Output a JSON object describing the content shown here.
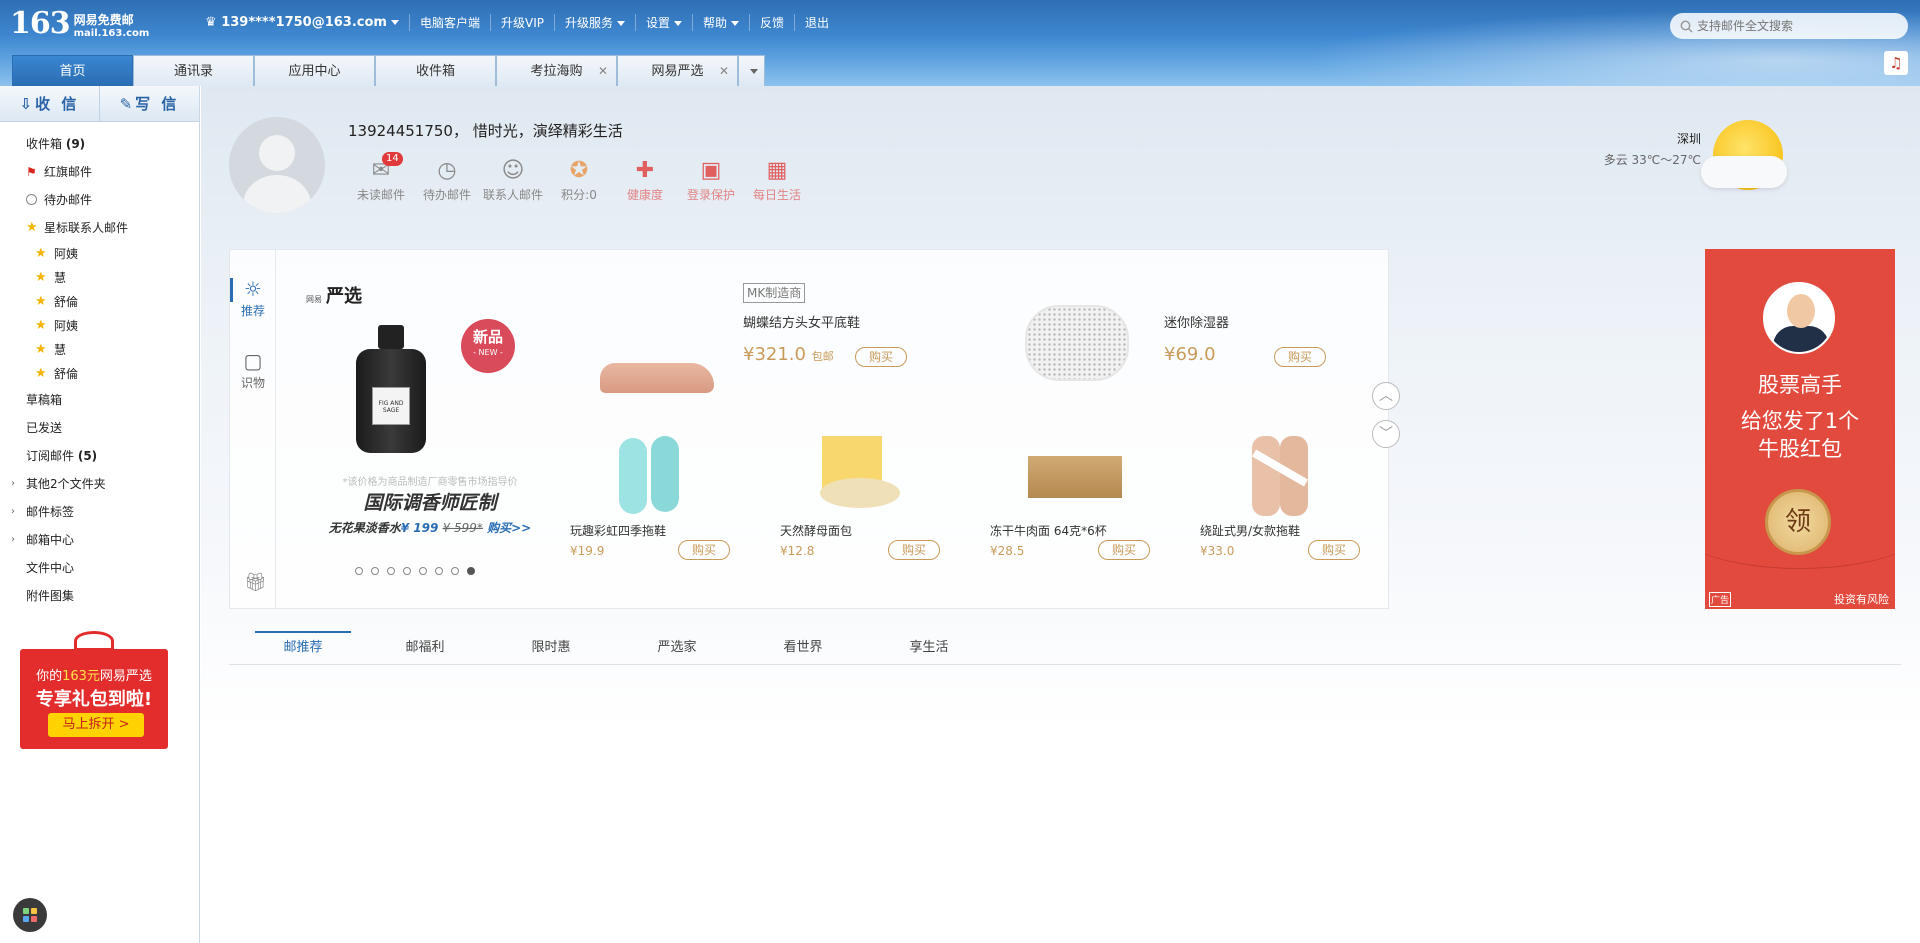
{
  "header": {
    "logo_num": "163",
    "logo_name": "网易免费邮",
    "logo_domain": "mail.163.com",
    "account": "139****1750@163.com",
    "links": [
      "电脑客户端",
      "升级VIP",
      "升级服务",
      "设置",
      "帮助",
      "反馈",
      "退出"
    ],
    "search_placeholder": "支持邮件全文搜索"
  },
  "tabs": [
    {
      "label": "首页"
    },
    {
      "label": "通讯录"
    },
    {
      "label": "应用中心"
    },
    {
      "label": "收件箱"
    },
    {
      "label": "考拉海购"
    },
    {
      "label": "网易严选"
    }
  ],
  "sidebar": {
    "receive": "收 信",
    "write": "写 信",
    "folders": {
      "inbox": "收件箱",
      "inbox_count": "(9)",
      "flagged": "红旗邮件",
      "todo": "待办邮件",
      "starred": "星标联系人邮件",
      "contacts": [
        "阿姨",
        "慧",
        "舒倫",
        "阿姨",
        "慧",
        "舒倫"
      ],
      "drafts": "草稿箱",
      "sent": "已发送",
      "subs": "订阅邮件",
      "subs_count": "(5)",
      "other": "其他2个文件夹",
      "tags": "邮件标签",
      "center": "邮箱中心",
      "files": "文件中心",
      "attach": "附件图集"
    },
    "gift_ad": {
      "line1_pre": "你的",
      "line1_amt": "163元",
      "line1_post": "网易严选",
      "line2": "专享礼包到啦!",
      "button": "马上拆开 >"
    }
  },
  "profile": {
    "greeting": "13924451750， 惜时光，演绎精彩生活",
    "quick": [
      {
        "label": "未读邮件",
        "icon": "envelope-icon",
        "badge": "14"
      },
      {
        "label": "待办邮件",
        "icon": "clock-icon"
      },
      {
        "label": "联系人邮件",
        "icon": "contact-star-icon"
      },
      {
        "label": "积分:0",
        "icon": "coin-icon"
      },
      {
        "label": "健康度",
        "icon": "medkit-icon"
      },
      {
        "label": "登录保护",
        "icon": "lock-box-icon"
      },
      {
        "label": "每日生活",
        "icon": "calendar-icon"
      }
    ],
    "weather": {
      "city": "深圳",
      "desc": "多云 33℃～27℃"
    }
  },
  "panel": {
    "nav": [
      "推荐",
      "识物"
    ],
    "brand_small": "网易",
    "brand": "严选",
    "feature": {
      "new_tag": "新品",
      "new_tag_en": "- NEW -",
      "label_text": "FIG AND SAGE",
      "note": "*该价格为商品制造厂商零售市场指导价",
      "title": "国际调香师匠制",
      "sub_prefix": "无花果淡香水",
      "sub_price": "¥ 199",
      "sub_old": "¥ 599*",
      "sub_link": "购买>>"
    },
    "maker_tag": "MK制造商",
    "top_items": [
      {
        "name": "蝴蝶结方头女平底鞋",
        "price": "¥321.0",
        "extra": "包邮",
        "buy": "购买"
      },
      {
        "name": "迷你除湿器",
        "price": "¥69.0",
        "extra": "",
        "buy": "购买"
      }
    ],
    "bottom_items": [
      {
        "name": "玩趣彩虹四季拖鞋",
        "price": "¥19.9",
        "buy": "购买"
      },
      {
        "name": "天然酵母面包",
        "price": "¥12.8",
        "buy": "购买"
      },
      {
        "name": "冻干牛肉面 64克*6杯",
        "price": "¥28.5",
        "buy": "购买"
      },
      {
        "name": "绕趾式男/女款拖鞋",
        "price": "¥33.0",
        "buy": "购买"
      }
    ],
    "carousel_total": 8,
    "carousel_active": 8
  },
  "red_ad": {
    "title": "股票高手",
    "line2": "给您发了1个",
    "line3": "牛股红包",
    "coin": "领",
    "risk": "投资有风险",
    "ad_mark": "广告"
  },
  "bottom_tabs": [
    "邮推荐",
    "邮福利",
    "限时惠",
    "严选家",
    "看世界",
    "享生活"
  ]
}
